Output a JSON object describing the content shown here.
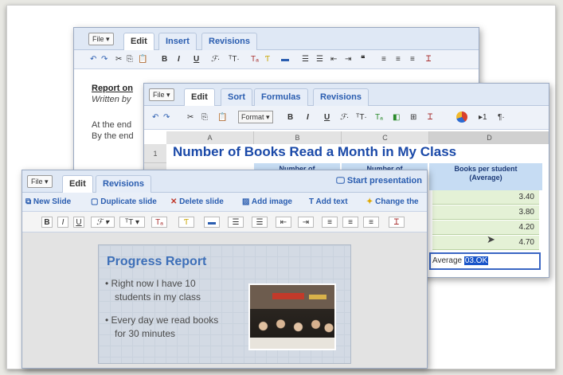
{
  "doc": {
    "file_label": "File ▾",
    "tabs": [
      "Edit",
      "Insert",
      "Revisions"
    ],
    "body_line1": "Report on",
    "body_line2": "Written by",
    "body_line3": "At the end",
    "body_line4": "By the end"
  },
  "sheet": {
    "file_label": "File ▾",
    "tabs": [
      "Edit",
      "Sort",
      "Formulas",
      "Revisions"
    ],
    "format_label": "Format ▾",
    "columns": [
      "A",
      "B",
      "C",
      "D"
    ],
    "row_numbers": [
      "1"
    ],
    "title": "Number of Books Read a Month in My Class",
    "headers": [
      "Number of",
      "Number of",
      "Books per student\n(Average)"
    ],
    "values": [
      "3.40",
      "3.80",
      "4.20",
      "4.70"
    ],
    "average_label": "Average",
    "average_value": "03.OK"
  },
  "slides": {
    "file_label": "File ▾",
    "tabs": [
      "Edit",
      "Revisions"
    ],
    "start_presentation": "Start presentation",
    "actions": [
      "New Slide",
      "Duplicate slide",
      "Delete slide",
      "Add image",
      "Add text",
      "Change the"
    ],
    "slide_title": "Progress Report",
    "bullets": [
      [
        "Right now I have 10",
        "students in my class"
      ],
      [
        "Every day we read books",
        "for 30 minutes"
      ]
    ]
  },
  "colors": {
    "accent_blue": "#2a5db0",
    "title_blue": "#1a49a8",
    "tab_bg": "#dfe8f5",
    "selection": "#1a55c9"
  }
}
